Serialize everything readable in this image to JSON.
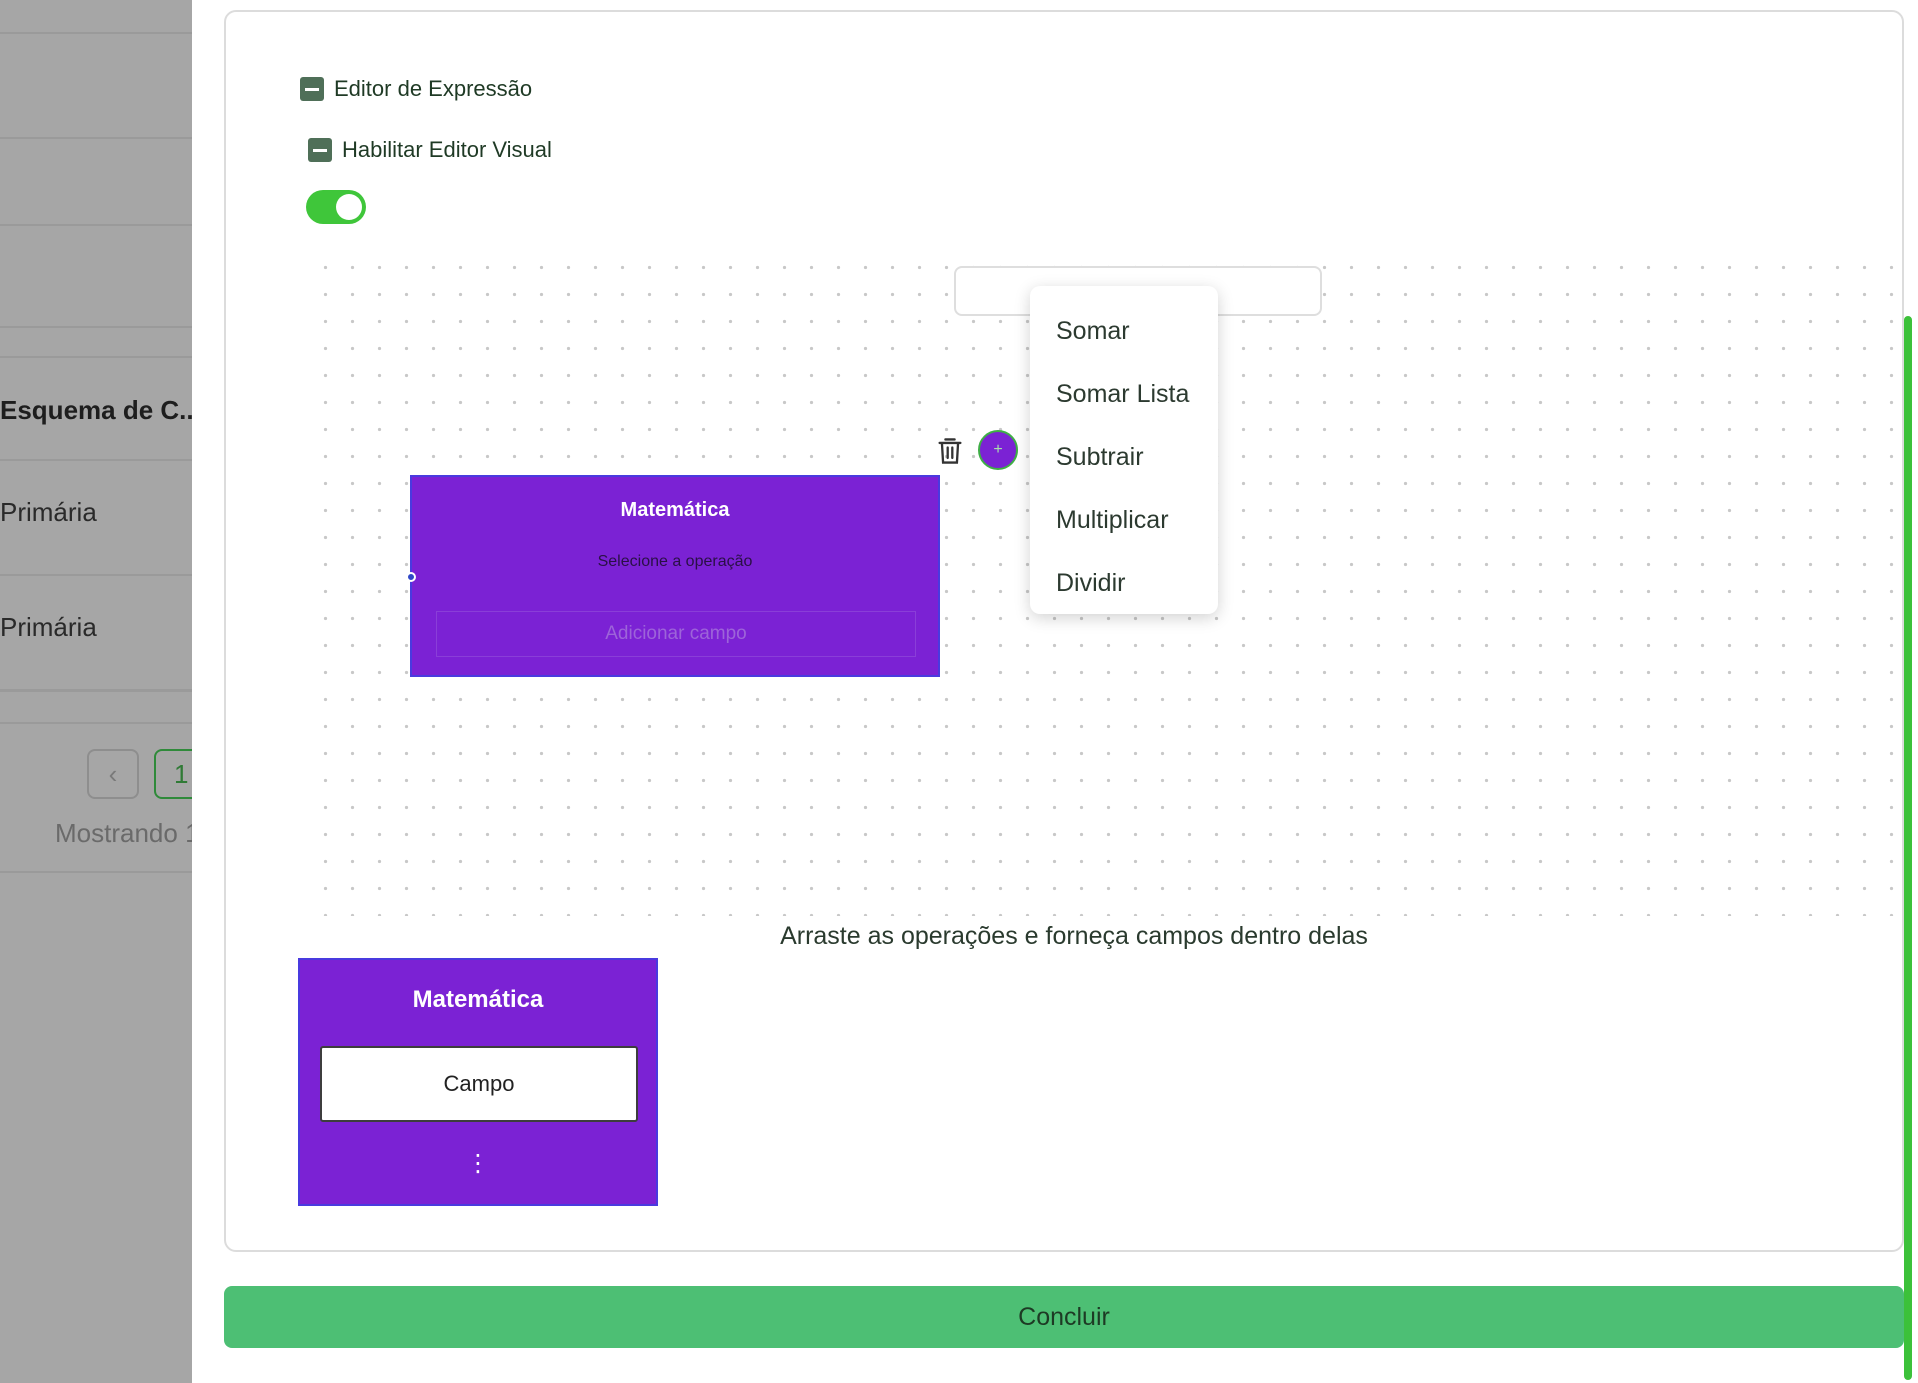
{
  "background": {
    "schema_label": "Esquema de C...",
    "rows": [
      "Primária",
      "Primária"
    ],
    "pagination": {
      "prev_icon": "chevron-left-icon",
      "page": "1",
      "showing": "Mostrando 1"
    }
  },
  "editor": {
    "expression_editor_label": "Editor de Expressão",
    "visual_editor_label": "Habilitar Editor Visual",
    "visual_editor_enabled": true,
    "canvas_node": {
      "title": "Matemática",
      "subtitle": "Selecione a operação",
      "add_field_placeholder": "Adicionar campo"
    },
    "operations_menu": [
      "Somar",
      "Somar Lista",
      "Subtrair",
      "Multiplicar",
      "Dividir"
    ],
    "hint": "Arraste as operações e forneça campos dentro delas",
    "palette_node": {
      "title": "Matemática",
      "field_label": "Campo",
      "more_icon": "⋮"
    }
  },
  "footer": {
    "conclude_label": "Concluir"
  },
  "colors": {
    "node_purple": "#7b22d4",
    "toggle_green": "#3fc63a",
    "button_green": "#4dbf74",
    "scrollbar_green": "#3cc13a"
  }
}
